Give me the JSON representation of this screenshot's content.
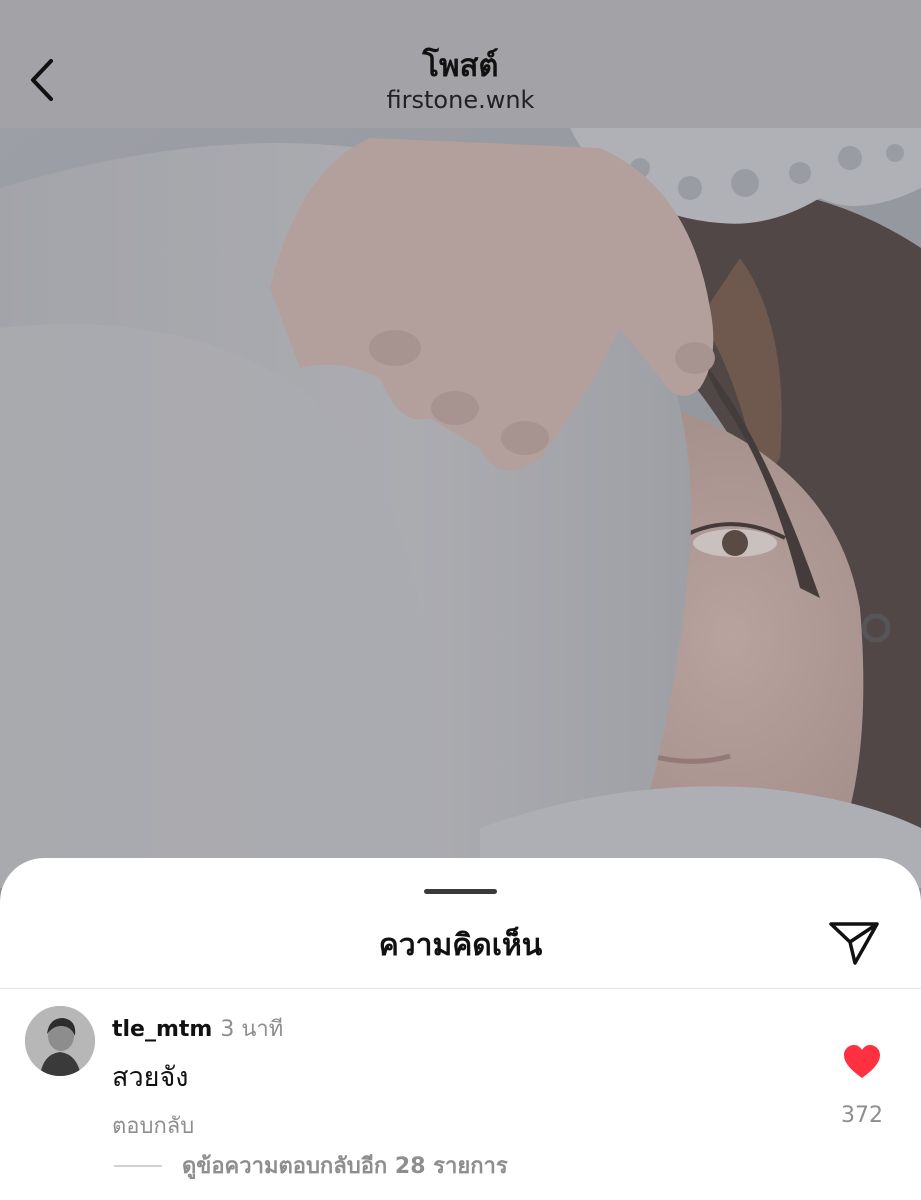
{
  "header": {
    "title": "โพสต์",
    "subtitle": "firstone.wnk",
    "back_icon": "chevron-left-icon"
  },
  "photo": {
    "description_icon": "post-photo"
  },
  "comments_sheet": {
    "title": "ความคิดเห็น",
    "share_icon": "paper-plane-icon",
    "comments": [
      {
        "username": "tle_mtm",
        "time": "3 นาที",
        "text": "สวยจัง",
        "reply_label": "ตอบกลับ",
        "liked": true,
        "like_count": "372",
        "more_replies_label": "ดูข้อความตอบกลับอีก 28 รายการ"
      }
    ]
  },
  "colors": {
    "header_bg": "#a2a2a7",
    "like_red": "#ff3040",
    "secondary_text": "#8e8e8e"
  }
}
